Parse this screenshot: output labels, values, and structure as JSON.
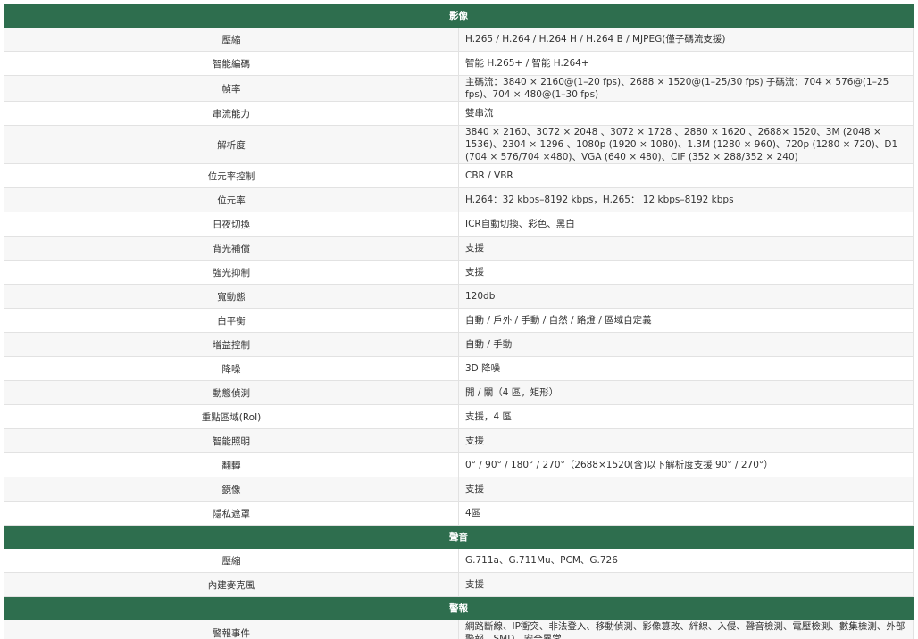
{
  "sections": [
    {
      "title": "影像",
      "rows": [
        {
          "label": "壓縮",
          "value": "H.265 / H.264 / H.264 H / H.264 B / MJPEG(僅子碼流支援)"
        },
        {
          "label": "智能編碼",
          "value": "智能 H.265+ / 智能 H.264+"
        },
        {
          "label": "幀率",
          "value": "主碼流：3840 × 2160@(1–20 fps)、2688 × 1520@(1–25/30 fps) 子碼流：704 × 576@(1–25 fps)、704 × 480@(1–30 fps)"
        },
        {
          "label": "串流能力",
          "value": "雙串流"
        },
        {
          "label": "解析度",
          "value": "3840 × 2160、3072 × 2048 、3072 × 1728 、2880 × 1620 、2688× 1520、3M (2048 × 1536)、2304 × 1296 、1080p (1920 × 1080)、1.3M (1280 × 960)、720p (1280 × 720)、D1 (704 × 576/704 ×480)、VGA (640 × 480)、CIF (352 × 288/352 × 240)"
        },
        {
          "label": "位元率控制",
          "value": "CBR / VBR"
        },
        {
          "label": "位元率",
          "value": "H.264：32 kbps–8192 kbps，H.265： 12 kbps–8192 kbps"
        },
        {
          "label": "日夜切換",
          "value": "ICR自動切換、彩色、黑白"
        },
        {
          "label": "背光補償",
          "value": "支援"
        },
        {
          "label": "強光抑制",
          "value": "支援"
        },
        {
          "label": "寬動態",
          "value": "120db"
        },
        {
          "label": "白平衡",
          "value": "自動 / 戶外 / 手動 / 自然 / 路燈 / 區域自定義"
        },
        {
          "label": "增益控制",
          "value": "自動 / 手動"
        },
        {
          "label": "降噪",
          "value": "3D 降噪"
        },
        {
          "label": "動態偵測",
          "value": "開 / 關（4 區，矩形）"
        },
        {
          "label": "重點區域(RoI)",
          "value": "支援，4 區"
        },
        {
          "label": "智能照明",
          "value": "支援"
        },
        {
          "label": "翻轉",
          "value": "0° / 90° / 180° / 270°（2688×1520(含)以下解析度支援 90° / 270°）"
        },
        {
          "label": "鏡像",
          "value": "支援"
        },
        {
          "label": "隱私遮罩",
          "value": "4區"
        }
      ]
    },
    {
      "title": "聲音",
      "rows": [
        {
          "label": "壓縮",
          "value": "G.711a、G.711Mu、PCM、G.726"
        },
        {
          "label": "內建麥克風",
          "value": "支援"
        }
      ]
    },
    {
      "title": "警報",
      "rows": [
        {
          "label": "警報事件",
          "value": "網路斷線、IP衝突、非法登入、移動偵測、影像篡改、絆線、入侵、聲音檢測、電壓檢測、數集檢測、外部警報、SMD、安全異常"
        }
      ]
    }
  ]
}
